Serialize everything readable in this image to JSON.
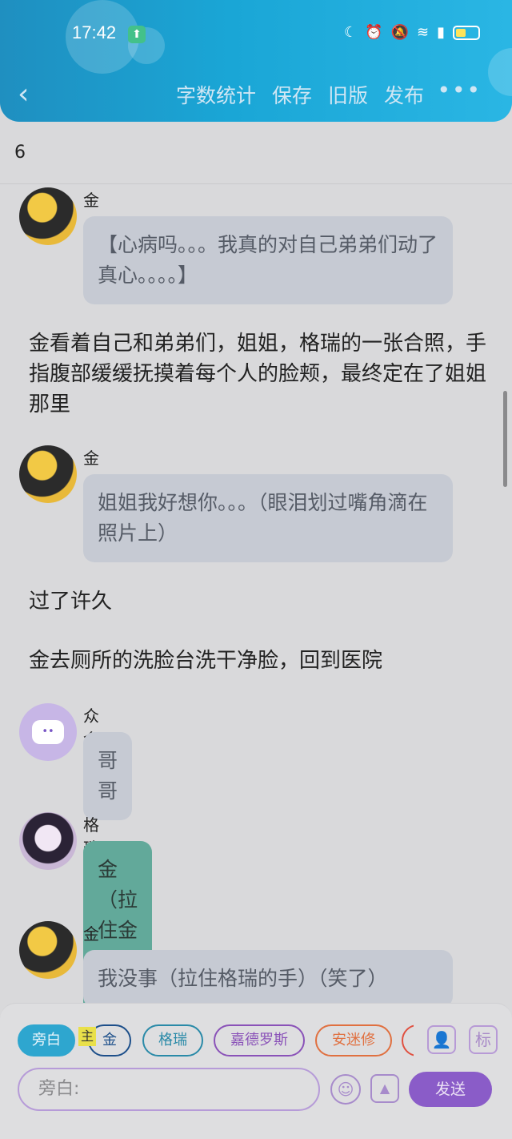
{
  "status": {
    "time": "17:42",
    "app_badge": "⬆"
  },
  "header": {
    "back": "‹",
    "actions": [
      "字数统计",
      "保存",
      "旧版",
      "发布"
    ],
    "more": "•••"
  },
  "count": "6",
  "messages": {
    "m1": {
      "name": "金",
      "text": "【心病吗。。。我真的对自己弟弟们动了真心。。。。】"
    },
    "n1": "金看着自己和弟弟们，姐姐，格瑞的一张合照，手指腹部缓缓抚摸着每个人的脸颊，最终定在了姐姐那里",
    "m2": {
      "name": "金",
      "text": "姐姐我好想你。。。（眼泪划过嘴角滴在照片上）"
    },
    "n2": "过了许久",
    "n3": "金去厕所的洗脸台洗干净脸，回到医院",
    "m3": {
      "name": "众金",
      "text": "哥哥"
    },
    "m4": {
      "name": "格瑞",
      "text": "金（拉住金的手）"
    },
    "m5": {
      "name": "金",
      "text": "我没事（拉住格瑞的手）（笑了）"
    }
  },
  "panel": {
    "chips": [
      "旁白",
      "金",
      "格瑞",
      "嘉德罗斯",
      "安迷修"
    ],
    "marker": "主",
    "profile_icon": "👤",
    "tag_icon": "标",
    "input_placeholder": "旁白:",
    "send": "发送"
  },
  "colors": {
    "header": "#1aa6d6",
    "chip_active": "#2ea6cf",
    "chip_jin": "#1d4f8a",
    "chip_gerui": "#2a8aa8",
    "chip_jiade": "#8a52b8",
    "chip_anmi": "#e07040",
    "send": "#8a5cc8"
  }
}
